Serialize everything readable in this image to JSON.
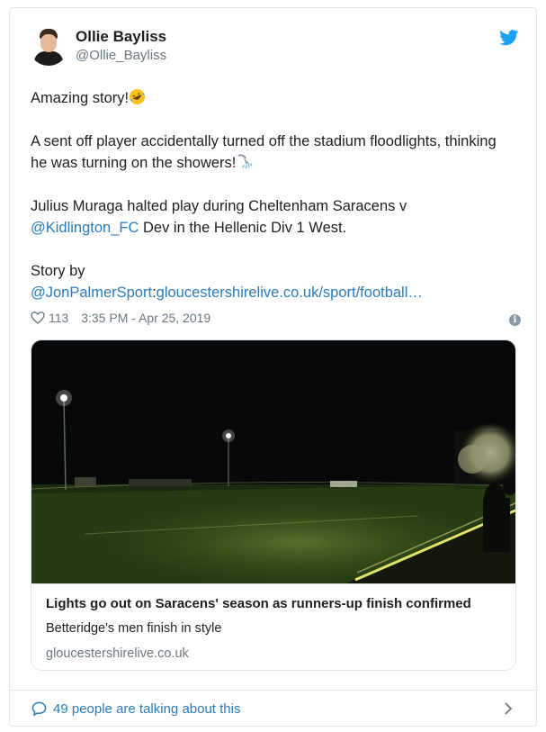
{
  "tweet": {
    "author": {
      "display_name": "Ollie Bayliss",
      "handle": "@Ollie_Bayliss",
      "avatar_icon": "avatar-photo"
    },
    "brand_icon": "twitter-bird-icon",
    "brand_color": "#1da1f2",
    "text": {
      "line1": "Amazing story!",
      "line1_emoji": "rolling-on-floor-laughing-emoji",
      "line2": "A sent off player accidentally turned off the stadium floodlights, thinking he was turning on the showers!",
      "line2_emoji": "shower-emoji",
      "line3_before": "Julius Muraga halted play during Cheltenham Saracens v ",
      "line3_mention": "@Kidlington_FC",
      "line3_after": " Dev in the Hellenic Div 1 West.",
      "line4": "Story by",
      "line5_mention": "@JonPalmerSport",
      "line5_sep": ":",
      "line5_link": "gloucestershirelive.co.uk/sport/football…"
    },
    "meta": {
      "likes": "113",
      "timestamp": "3:35 PM - Apr 25, 2019",
      "info_icon": "info-icon"
    },
    "card": {
      "image_description_icon": "night-football-pitch-photo",
      "title": "Lights go out on Saracens' season as runners-up finish confirmed",
      "description": "Betteridge's men finish in style",
      "domain": "gloucestershirelive.co.uk"
    },
    "footer": {
      "talking": "49 people are talking about this"
    },
    "colors": {
      "text": "#1c2022",
      "muted": "#697882",
      "link": "#2b7bb9",
      "border": "#e1e8ed"
    }
  }
}
